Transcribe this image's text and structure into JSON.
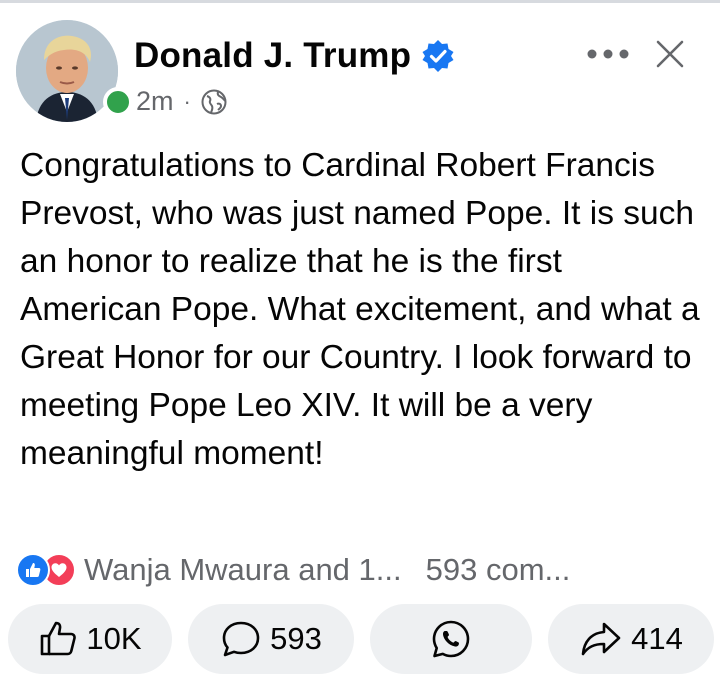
{
  "post": {
    "author": "Donald J. Trump",
    "verified": true,
    "time": "2m",
    "separator": "·",
    "audience_icon": "globe-icon",
    "text": "Congratulations to Cardinal Robert Francis Prevost, who was just named Pope. It is such an honor to realize that he is the first American Pope. What excitement, and what a Great Honor for our Country. I look forward to meeting Pope Leo XIV. It will be a very meaningful moment!"
  },
  "stats": {
    "reactions": [
      "like-reaction-icon",
      "love-reaction-icon"
    ],
    "reactors": "Wanja Mwaura and 1...",
    "comments": "593 com..."
  },
  "actions": {
    "like": "10K",
    "comment": "593",
    "whatsapp_icon": "whatsapp-icon",
    "share": "414"
  },
  "colors": {
    "verified": "#1877f2",
    "presence": "#31a24c",
    "like": "#1877f2",
    "love": "#f33e58",
    "button_bg": "#eef0f2",
    "secondary_text": "#65676b"
  }
}
